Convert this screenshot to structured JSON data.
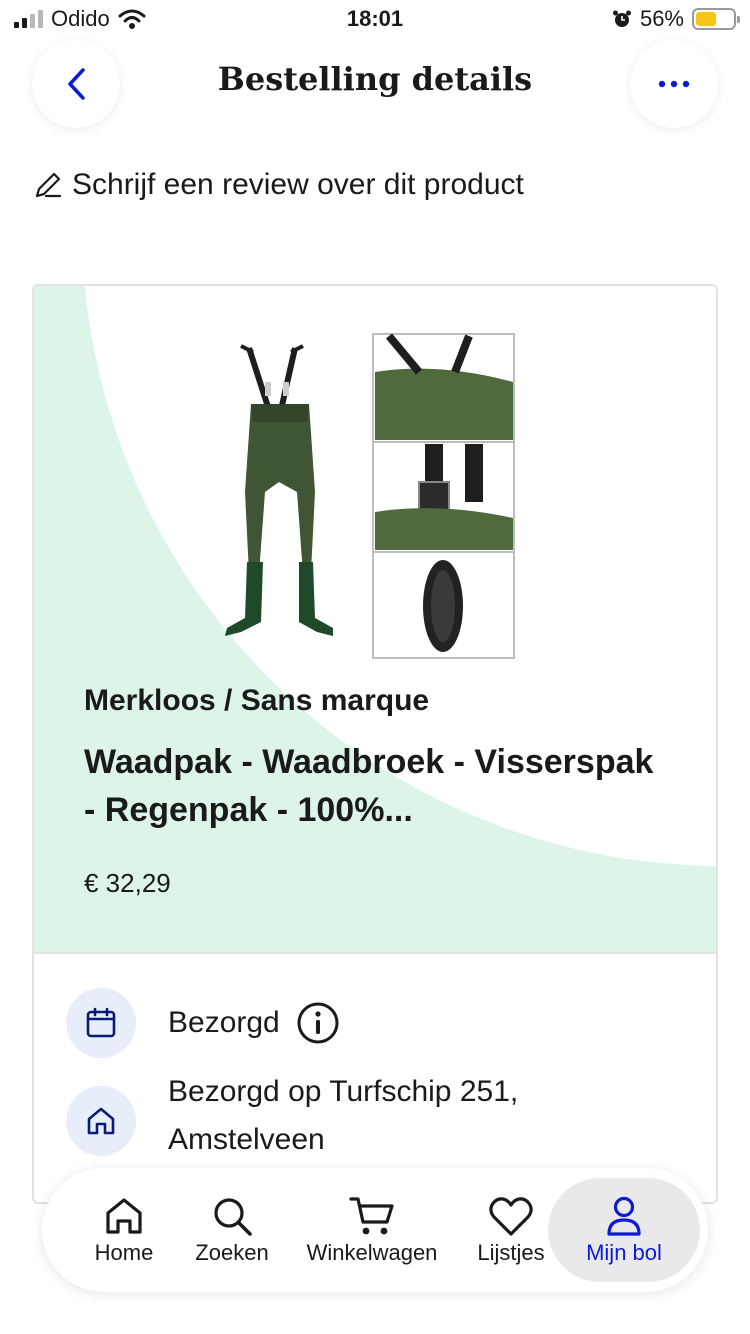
{
  "status_bar": {
    "carrier": "Odido",
    "time": "18:01",
    "battery_percent": "56%",
    "battery_level": 0.56,
    "icons": [
      "signal-icon",
      "wifi-icon",
      "alarm-icon",
      "battery-icon"
    ]
  },
  "header": {
    "title": "Bestelling details",
    "back_icon": "chevron-left-icon",
    "more_icon": "ellipsis-icon"
  },
  "review": {
    "icon": "pencil-icon",
    "label": "Schrijf een review over dit product"
  },
  "product": {
    "brand": "Merkloos / Sans marque",
    "title": "Waadpak - Waadbroek - Visserspak - Regenpak - 100%...",
    "price": "€ 32,29"
  },
  "delivery": {
    "status": "Bezorgd",
    "status_icon": "calendar-icon",
    "info_icon": "info-icon",
    "address": "Bezorgd op Turfschip 251, Amstelveen",
    "address_icon": "home-icon"
  },
  "nav": {
    "items": [
      {
        "label": "Home",
        "icon": "home-icon"
      },
      {
        "label": "Zoeken",
        "icon": "search-icon"
      },
      {
        "label": "Winkelwagen",
        "icon": "cart-icon"
      },
      {
        "label": "Lijstjes",
        "icon": "heart-icon"
      },
      {
        "label": "Mijn bol",
        "icon": "user-icon"
      }
    ],
    "active": "Mijn bol"
  },
  "colors": {
    "accent": "#0d1bd4",
    "card_green": "#dcf5e8",
    "icon_bg": "#e8eef9",
    "battery": "#f5c518"
  }
}
